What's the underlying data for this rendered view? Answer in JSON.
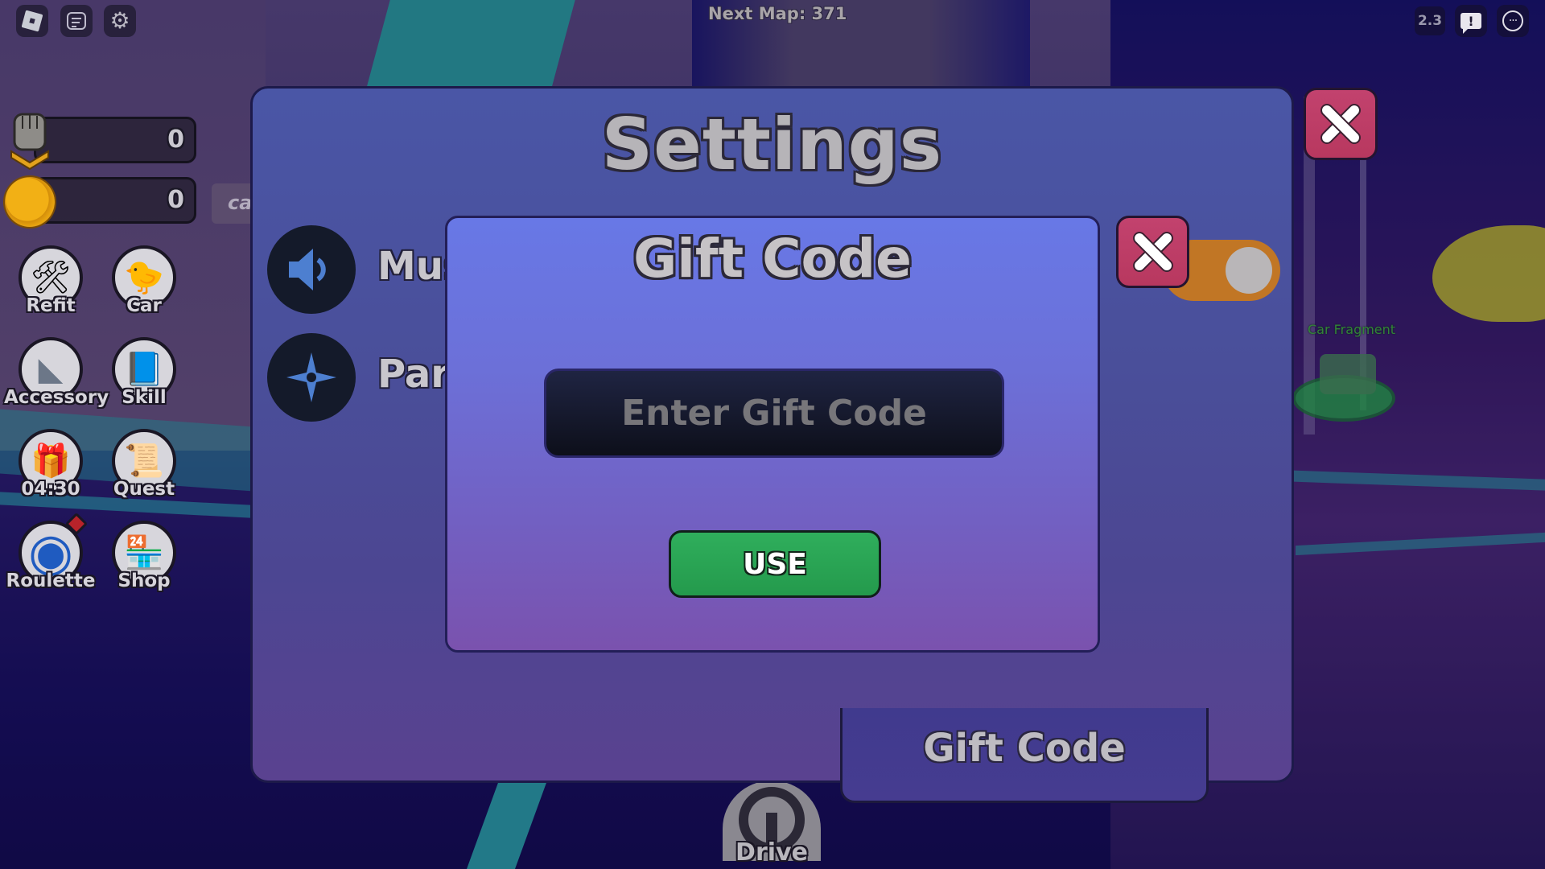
{
  "topbar": {
    "next_map": "Next Map: 371",
    "fps": "2.3",
    "report_glyph": "!",
    "more_glyph": "···"
  },
  "currencies": [
    {
      "icon": "fist-icon",
      "value": "0"
    },
    {
      "icon": "coin-icon",
      "value": "0"
    }
  ],
  "side_tag": "ca",
  "menu": [
    {
      "label": "Refit",
      "icon": "wrench-brush-icon",
      "glyph": "🛠"
    },
    {
      "label": "Car",
      "icon": "duck-car-icon",
      "glyph": "🐤"
    },
    {
      "label": "Accessory",
      "icon": "cone-icon",
      "glyph": "◣"
    },
    {
      "label": "Skill",
      "icon": "skill-book-icon",
      "glyph": "📘"
    },
    {
      "label": "04:30",
      "icon": "gift-icon",
      "glyph": "🎁"
    },
    {
      "label": "Quest",
      "icon": "scroll-icon",
      "glyph": "📜"
    },
    {
      "label": "Roulette",
      "icon": "roulette-wheel-icon",
      "glyph": "◉"
    },
    {
      "label": "Shop",
      "icon": "shop-icon",
      "glyph": "🏪"
    }
  ],
  "world": {
    "fragment_label": "Car Fragment"
  },
  "settings": {
    "title": "Settings",
    "rows": [
      {
        "label": "Music",
        "icon": "speaker-icon",
        "visible_text": "Mus"
      },
      {
        "label": "Particles",
        "icon": "sparkle-icon",
        "visible_text": "Part"
      }
    ],
    "toggle_on": true,
    "gift_code_tab": "Gift Code"
  },
  "gift_modal": {
    "title": "Gift Code",
    "input_value": "",
    "input_placeholder": "Enter Gift Code",
    "use_button": "USE"
  },
  "drive": {
    "label": "Drive"
  },
  "colors": {
    "close_red": "#c2426e",
    "use_green": "#2fae5c",
    "toggle_orange": "#c17625",
    "modal_top": "#6878e6",
    "settings_bg": "#4a56a6"
  }
}
